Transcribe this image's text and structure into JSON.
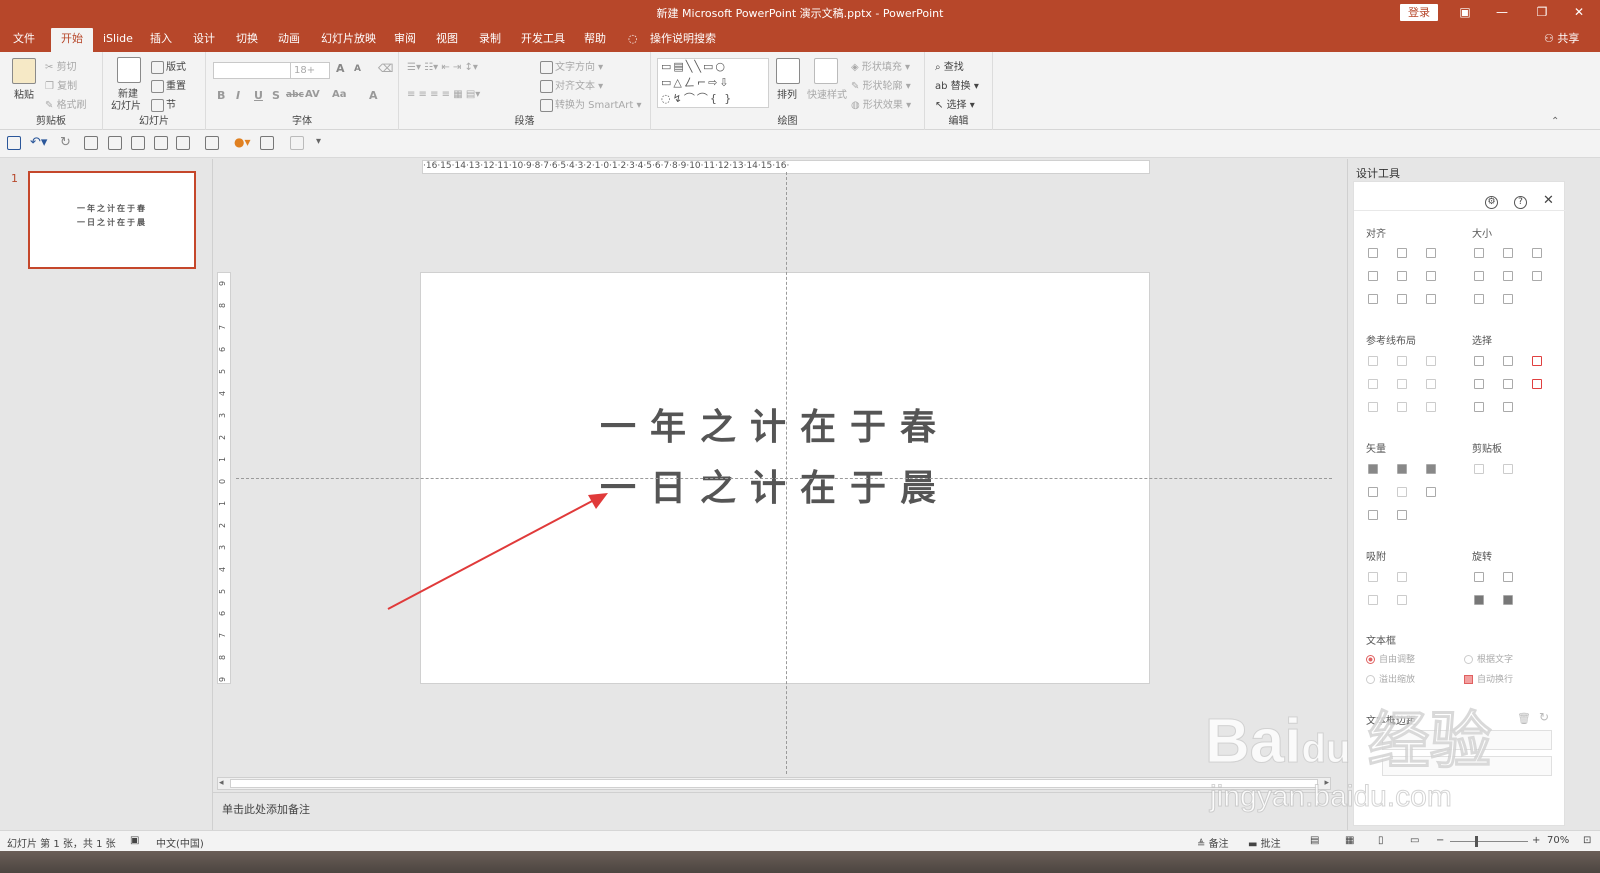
{
  "titlebar": {
    "title": "新建 Microsoft PowerPoint 演示文稿.pptx  -  PowerPoint",
    "login": "登录",
    "minimize": "—",
    "restore": "❐",
    "close": "✕",
    "ribbon_display": "▣"
  },
  "tabs": [
    {
      "label": "文件"
    },
    {
      "label": "开始"
    },
    {
      "label": "iSlide"
    },
    {
      "label": "插入"
    },
    {
      "label": "设计"
    },
    {
      "label": "切换"
    },
    {
      "label": "动画"
    },
    {
      "label": "幻灯片放映"
    },
    {
      "label": "审阅"
    },
    {
      "label": "视图"
    },
    {
      "label": "录制"
    },
    {
      "label": "开发工具"
    },
    {
      "label": "帮助"
    },
    {
      "label": "操作说明搜索"
    }
  ],
  "share": "共享",
  "ribbon": {
    "clipboard": {
      "paste": "粘贴",
      "cut": "剪切",
      "copy": "复制",
      "format_painter": "格式刷",
      "label": "剪贴板"
    },
    "slides": {
      "new_slide": "新建",
      "new_slide2": "幻灯片",
      "layout": "版式",
      "reset": "重置",
      "section": "节",
      "label": "幻灯片"
    },
    "font": {
      "font_size": "18+",
      "label": "字体",
      "bold": "B",
      "italic": "I",
      "underline": "U",
      "shadow": "S",
      "strike": "abc",
      "spacing": "AV",
      "case": "Aa",
      "color": "A",
      "grow": "A",
      "shrink": "A"
    },
    "paragraph": {
      "text_direction": "文字方向",
      "align_text": "对齐文本",
      "smartart": "转换为 SmartArt",
      "label": "段落"
    },
    "drawing": {
      "arrange": "排列",
      "quick_styles": "快速样式",
      "shape_fill": "形状填充",
      "shape_outline": "形状轮廓",
      "shape_effects": "形状效果",
      "label": "绘图"
    },
    "editing": {
      "find": "查找",
      "replace": "替换",
      "select": "选择",
      "label": "编辑"
    }
  },
  "thumbnail": {
    "number": "1",
    "line1": "一年之计在于春",
    "line2": "一日之计在于晨"
  },
  "ruler": {
    "horizontal": "·16·15·14·13·12·11·10·9·8·7·6·5·4·3·2·1·0·1·2·3·4·5·6·7·8·9·10·11·12·13·14·15·16·",
    "vertical": [
      "9",
      "8",
      "7",
      "6",
      "5",
      "4",
      "3",
      "2",
      "1",
      "0",
      "1",
      "2",
      "3",
      "4",
      "5",
      "6",
      "7",
      "8",
      "9"
    ]
  },
  "slide": {
    "line1": "一年之计在于春",
    "line2": "一日之计在于晨"
  },
  "notes": {
    "placeholder": "单击此处添加备注"
  },
  "design_panel": {
    "title": "设计工具",
    "sections": {
      "align": "对齐",
      "size": "大小",
      "guides": "参考线布局",
      "select": "选择",
      "vector": "矢量",
      "clipboard": "剪贴板",
      "snap": "吸附",
      "rotate": "旋转",
      "textbox": "文本框",
      "margin": "文本框边距"
    },
    "textbox_options": {
      "auto_adjust": "自由调整",
      "fit_text": "根据文字",
      "overflow": "溢出缩放",
      "auto_wrap": "自动换行"
    }
  },
  "status": {
    "slide_info": "幻灯片 第 1 张，共 1 张",
    "language": "中文(中国)",
    "notes": "备注",
    "comments": "批注",
    "zoom": "70%"
  },
  "watermark": {
    "logo": "Bai du 经验",
    "url": "jingyan.baidu.com"
  },
  "colors": {
    "accent": "#b7472a",
    "arrow": "#e03a3a",
    "selected_border": "#c5472b"
  }
}
